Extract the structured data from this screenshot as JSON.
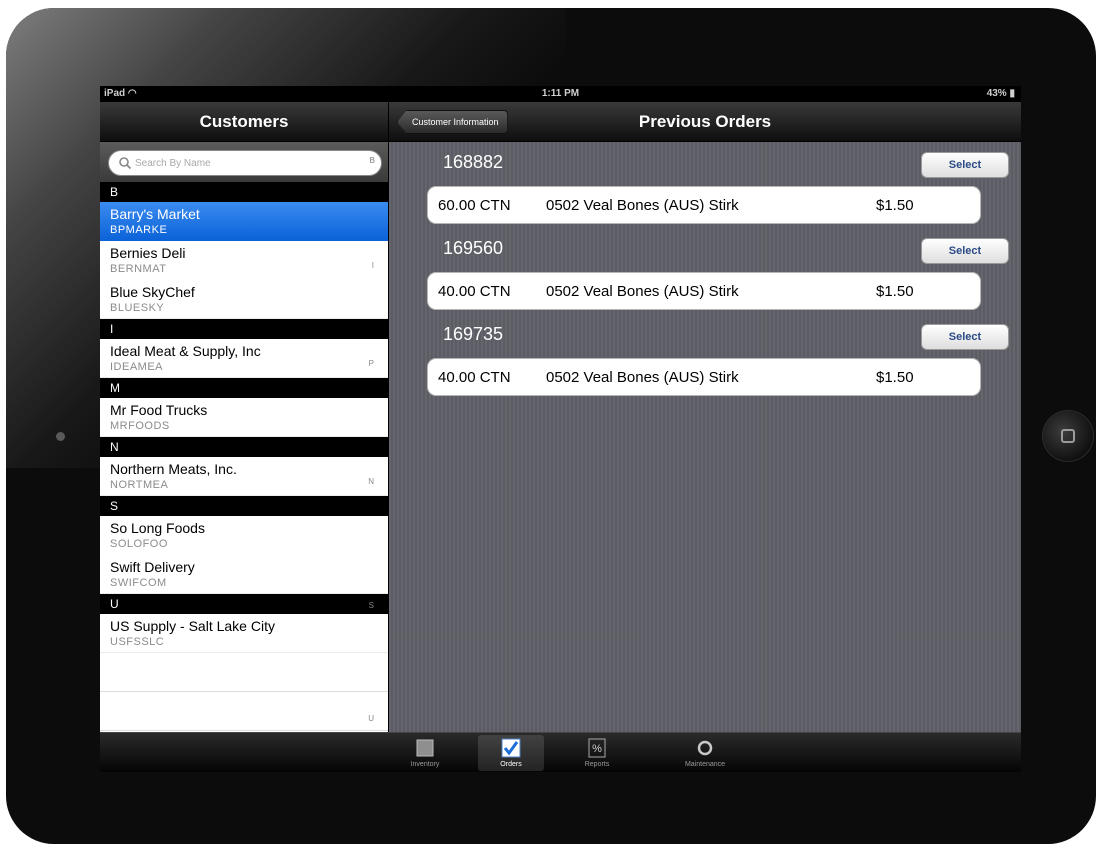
{
  "status_bar": {
    "device": "iPad",
    "time": "1:11 PM",
    "battery": "43%"
  },
  "customers_pane": {
    "title": "Customers",
    "search_placeholder": "Search By Name",
    "top_index": "B",
    "sections": [
      {
        "letter": "B",
        "index": "",
        "rows": [
          {
            "name": "Barry's Market",
            "code": "BPMARKE",
            "selected": true,
            "index": ""
          },
          {
            "name": "Bernies Deli",
            "code": "BERNMAT",
            "selected": false,
            "index": "I"
          },
          {
            "name": "Blue SkyChef",
            "code": "BLUESKY",
            "selected": false,
            "index": ""
          }
        ]
      },
      {
        "letter": "I",
        "index": "",
        "rows": [
          {
            "name": "Ideal Meat & Supply, Inc",
            "code": "IDEAMEA",
            "selected": false,
            "index": "P"
          }
        ]
      },
      {
        "letter": "M",
        "index": "",
        "rows": [
          {
            "name": "Mr Food Trucks",
            "code": "MRFOODS",
            "selected": false,
            "index": ""
          }
        ]
      },
      {
        "letter": "N",
        "index": "",
        "rows": [
          {
            "name": "Northern Meats, Inc.",
            "code": "NORTMEA",
            "selected": false,
            "index": "N"
          }
        ]
      },
      {
        "letter": "S",
        "index": "",
        "rows": [
          {
            "name": "So Long Foods",
            "code": "SOLOFOO",
            "selected": false,
            "index": ""
          },
          {
            "name": "Swift Delivery",
            "code": "SWIFCOM",
            "selected": false,
            "index": ""
          }
        ]
      },
      {
        "letter": "U",
        "index": "S",
        "rows": [
          {
            "name": "US Supply - Salt Lake City",
            "code": "USFSSLC",
            "selected": false,
            "index": ""
          }
        ]
      }
    ],
    "bottom_index": "U"
  },
  "orders_pane": {
    "back_label": "Customer Information",
    "title": "Previous Orders",
    "select_label": "Select",
    "orders": [
      {
        "number": "168882",
        "qty": "60.00 CTN",
        "description": "0502 Veal Bones (AUS) Stirk",
        "price": "$1.50"
      },
      {
        "number": "169560",
        "qty": "40.00 CTN",
        "description": "0502 Veal Bones (AUS) Stirk",
        "price": "$1.50"
      },
      {
        "number": "169735",
        "qty": "40.00 CTN",
        "description": "0502 Veal Bones (AUS) Stirk",
        "price": "$1.50"
      }
    ]
  },
  "tab_bar": {
    "tabs": [
      {
        "label": "Inventory",
        "icon": "box-icon",
        "active": false
      },
      {
        "label": "Orders",
        "icon": "checkmark-icon",
        "active": true
      },
      {
        "label": "Reports",
        "icon": "percent-icon",
        "active": false
      },
      {
        "label": "Maintenance",
        "icon": "gear-icon",
        "active": false
      }
    ]
  },
  "colors": {
    "accent": "#0b62d8",
    "select_text": "#2b4a86",
    "pane_background": "#5f6067"
  }
}
